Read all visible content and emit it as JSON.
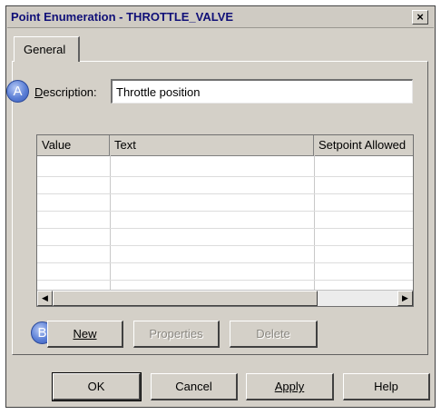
{
  "window": {
    "title": "Point Enumeration - THROTTLE_VALVE",
    "close_glyph": "×"
  },
  "tabs": [
    {
      "label": "General",
      "active": true
    }
  ],
  "markers": {
    "a": "A",
    "b": "B"
  },
  "description": {
    "label": "Description:",
    "value": "Throttle position"
  },
  "grid": {
    "columns": [
      "Value",
      "Text",
      "Setpoint Allowed"
    ],
    "rows": [],
    "scroll_left": "◀",
    "scroll_right": "▶"
  },
  "panel_buttons": {
    "new": "New",
    "properties": "Properties",
    "delete": "Delete"
  },
  "dialog_buttons": {
    "ok": "OK",
    "cancel": "Cancel",
    "apply": "Apply",
    "help": "Help"
  },
  "colors": {
    "face": "#d4d0c8",
    "title_text": "#101078",
    "marker": "#5b7fd6"
  }
}
